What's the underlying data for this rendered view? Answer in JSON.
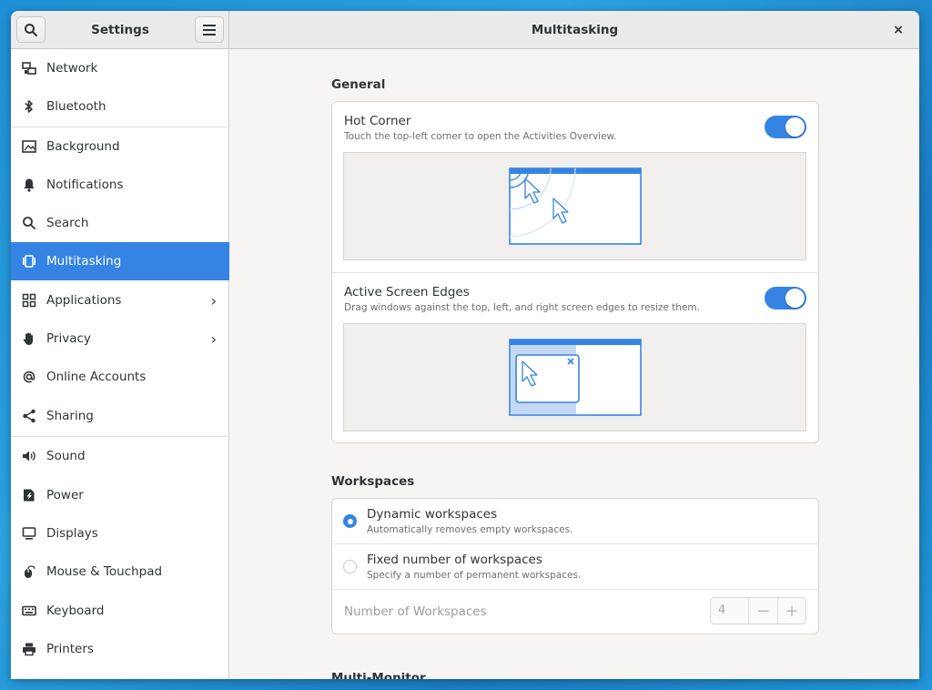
{
  "window": {
    "sidebar_title": "Settings",
    "page_title": "Multitasking",
    "close_symbol": "×"
  },
  "sidebar": {
    "items": [
      {
        "label": "Network",
        "icon": "network-icon"
      },
      {
        "label": "Bluetooth",
        "icon": "bluetooth-icon"
      },
      {
        "label": "Background",
        "icon": "background-icon"
      },
      {
        "label": "Notifications",
        "icon": "bell-icon"
      },
      {
        "label": "Search",
        "icon": "search-icon"
      },
      {
        "label": "Multitasking",
        "icon": "multitasking-icon",
        "active": true
      },
      {
        "label": "Applications",
        "icon": "grid-icon",
        "chevron": true
      },
      {
        "label": "Privacy",
        "icon": "hand-icon",
        "chevron": true
      },
      {
        "label": "Online Accounts",
        "icon": "at-icon"
      },
      {
        "label": "Sharing",
        "icon": "share-icon"
      },
      {
        "label": "Sound",
        "icon": "speaker-icon"
      },
      {
        "label": "Power",
        "icon": "power-icon"
      },
      {
        "label": "Displays",
        "icon": "display-icon"
      },
      {
        "label": "Mouse & Touchpad",
        "icon": "mouse-icon"
      },
      {
        "label": "Keyboard",
        "icon": "keyboard-icon"
      },
      {
        "label": "Printers",
        "icon": "printer-icon"
      }
    ],
    "chevron_symbol": "›"
  },
  "general": {
    "title": "General",
    "hot_corner": {
      "title": "Hot Corner",
      "subtitle": "Touch the top-left corner to open the Activities Overview.",
      "enabled": true
    },
    "active_edges": {
      "title": "Active Screen Edges",
      "subtitle": "Drag windows against the top, left, and right screen edges to resize them.",
      "enabled": true
    }
  },
  "workspaces": {
    "title": "Workspaces",
    "dynamic": {
      "title": "Dynamic workspaces",
      "subtitle": "Automatically removes empty workspaces.",
      "selected": true
    },
    "fixed": {
      "title": "Fixed number of workspaces",
      "subtitle": "Specify a number of permanent workspaces.",
      "selected": false
    },
    "number_label": "Number of Workspaces",
    "number_value": "4",
    "minus_symbol": "−",
    "plus_symbol": "+"
  },
  "multi_monitor": {
    "title": "Multi-Monitor"
  },
  "colors": {
    "accent": "#3584e4",
    "sidebar_bg": "#ffffff",
    "content_bg": "#f6f5f4",
    "desktop_bg": "#1f8fd6"
  }
}
